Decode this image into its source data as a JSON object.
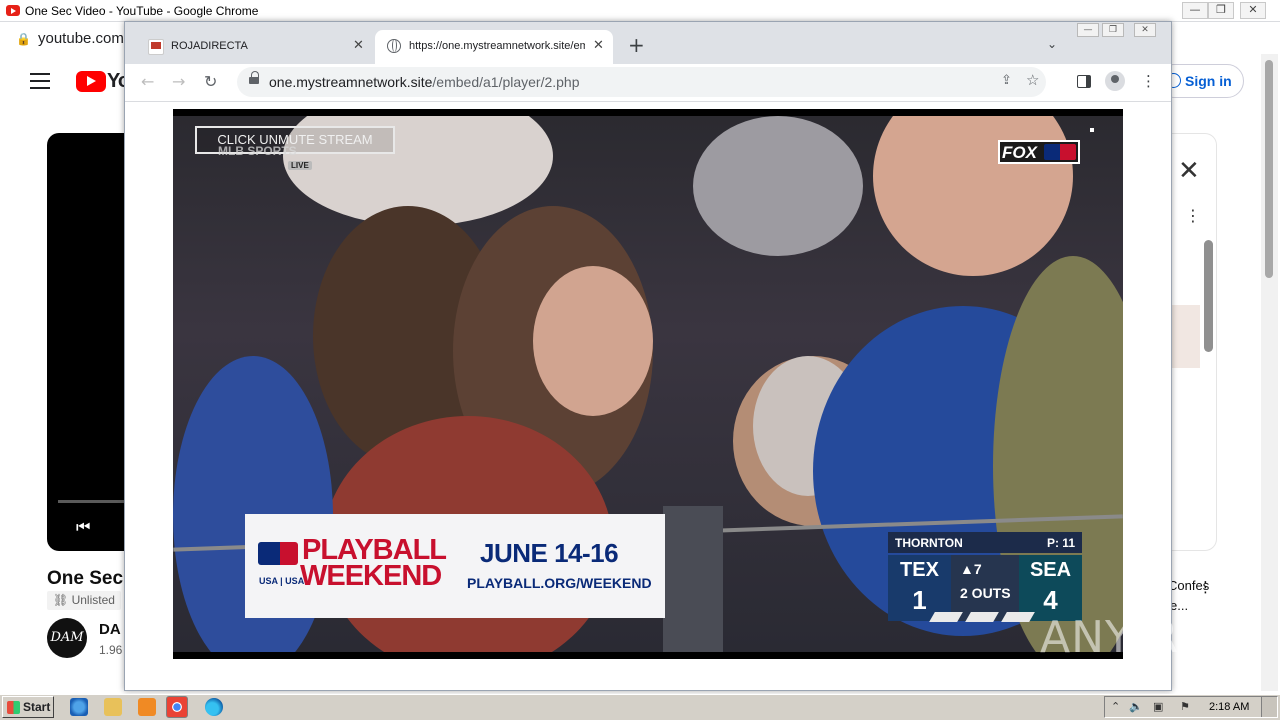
{
  "back_window": {
    "title": "One Sec Video - YouTube - Google Chrome",
    "url": "youtube.com/",
    "youtube": {
      "wordmark": "Yo",
      "video_title": "One Sec",
      "unlisted_label": "Unlisted",
      "channel_avatar_text": "DAM",
      "channel_name": "DA",
      "subscribers": "1.96",
      "sign_in_label": "Sign in",
      "side_video_title": "Confes",
      "side_video_sub": "e..."
    }
  },
  "front_window": {
    "tabs": [
      {
        "label": "ROJADIRECTA",
        "active": false
      },
      {
        "label": "https://one.mystreamnetwork.site/embed/a1/player/2.php",
        "active": true
      }
    ],
    "omnibox": {
      "host": "one.mystreamnetwork.site",
      "path": "/embed/a1/player/2.php"
    }
  },
  "stream": {
    "unmute_label": "CLICK UNMUTE STREAM",
    "network_bug": "MLB SPORTS",
    "live_tag": "LIVE",
    "broadcaster": "FOX",
    "ad": {
      "line1": "PLAYBALL",
      "line2": "WEEKEND",
      "partners": "USA | USA",
      "dates": "JUNE 14-16",
      "url": "PLAYBALL.ORG/WEEKEND"
    },
    "scorebug": {
      "batter": "THORNTON",
      "pitch_count": "P: 11",
      "away_team": "TEX",
      "away_runs": "1",
      "inning": "▲7",
      "outs": "2 OUTS",
      "home_team": "SEA",
      "home_runs": "4"
    }
  },
  "watermark": "ANY RUN",
  "taskbar": {
    "start_label": "Start",
    "clock": "2:18 AM"
  }
}
